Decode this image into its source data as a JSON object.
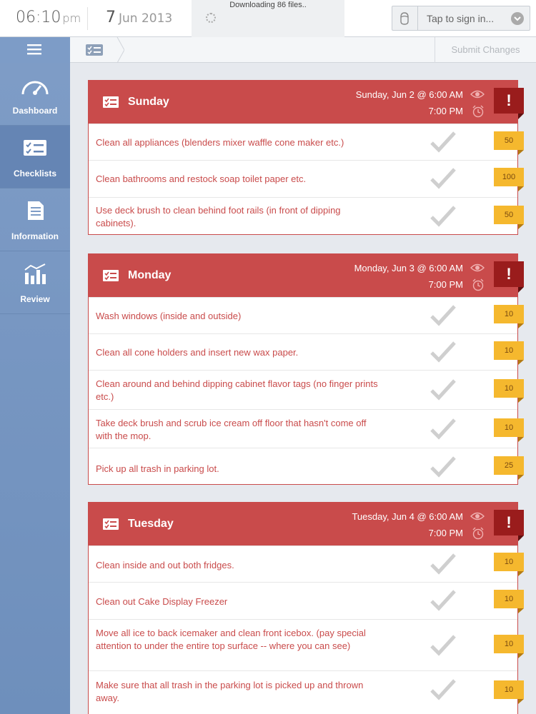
{
  "status": {
    "time": "06:10",
    "ampm": "pm",
    "date_day": "7",
    "date_rest": "Jun 2013",
    "download_text": "Downloading 86 files..",
    "signin_label": "Tap to sign in..."
  },
  "toolbar": {
    "menu_icon": "hamburger-icon",
    "breadcrumb_icon": "checklist-icon",
    "submit_label": "Submit Changes"
  },
  "sidebar": {
    "items": [
      {
        "label": "Dashboard",
        "icon": "speedometer-icon",
        "active": false
      },
      {
        "label": "Checklists",
        "icon": "checklist-icon",
        "active": true
      },
      {
        "label": "Information",
        "icon": "document-icon",
        "active": false
      },
      {
        "label": "Review",
        "icon": "bar-chart-icon",
        "active": false
      }
    ]
  },
  "colors": {
    "accent_red": "#c94b4b",
    "alert_dark_red": "#9a1c1c",
    "badge_yellow": "#f5b82e",
    "sidebar_blue": "#7e9cc6"
  },
  "lists": [
    {
      "day": "Sunday",
      "start": "Sunday, Jun 2 @ 6:00 AM",
      "end": "7:00 PM",
      "alert": "!",
      "tasks": [
        {
          "text": "Clean all appliances (blenders mixer waffle cone maker etc.)",
          "points": "50"
        },
        {
          "text": "Clean bathrooms and restock soap toilet paper etc.",
          "points": "100"
        },
        {
          "text": "Use deck brush to clean behind foot rails (in front of dipping cabinets).",
          "points": "50"
        }
      ]
    },
    {
      "day": "Monday",
      "start": "Monday, Jun 3 @ 6:00 AM",
      "end": "7:00 PM",
      "alert": "!",
      "tasks": [
        {
          "text": "Wash windows (inside and outside)",
          "points": "10"
        },
        {
          "text": "Clean all cone holders and insert new wax paper.",
          "points": "10"
        },
        {
          "text": "Clean around and behind dipping cabinet flavor tags (no finger prints etc.)",
          "points": "10"
        },
        {
          "text": "Take deck brush and scrub ice cream off floor that hasn't come off with the mop.",
          "points": "10"
        },
        {
          "text": "Pick up all trash in parking lot.",
          "points": "25"
        }
      ]
    },
    {
      "day": "Tuesday",
      "start": "Tuesday, Jun 4 @ 6:00 AM",
      "end": "7:00 PM",
      "alert": "!",
      "tasks": [
        {
          "text": "Clean inside and out both fridges.",
          "points": "10"
        },
        {
          "text": "Clean out Cake Display Freezer",
          "points": "10"
        },
        {
          "text": "Move all ice to back icemaker and clean front icebox. (pay special attention to under the entire top surface -- where you can see)",
          "points": "10"
        },
        {
          "text": "Make sure that all trash in the parking lot is picked up and thrown away.",
          "points": "10"
        }
      ]
    }
  ]
}
